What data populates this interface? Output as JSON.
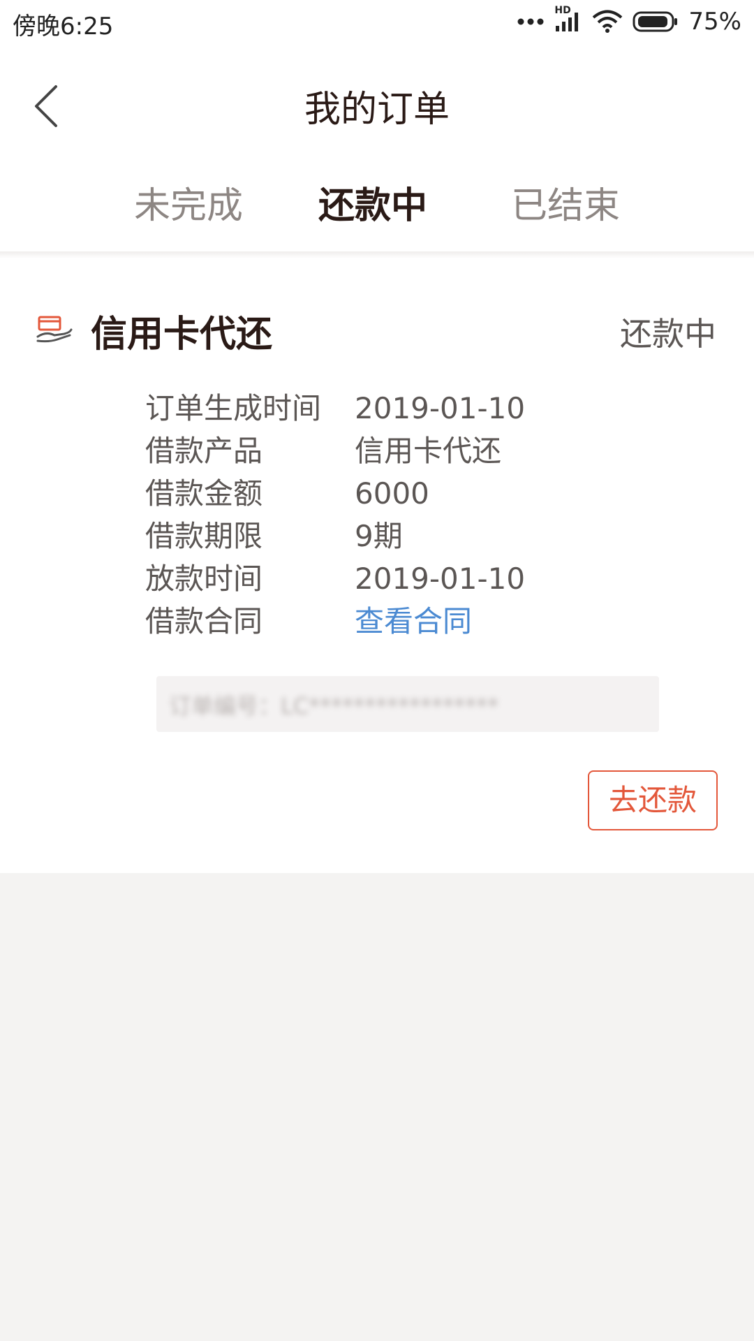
{
  "status_bar": {
    "time": "傍晚6:25",
    "battery": "75%",
    "network_badge": "HD",
    "icons": [
      "more-dots-icon",
      "signal-icon",
      "wifi-icon",
      "battery-icon"
    ]
  },
  "header": {
    "title": "我的订单",
    "back_icon": "chevron-left-icon"
  },
  "tabs": [
    {
      "label": "未完成",
      "active": false
    },
    {
      "label": "还款中",
      "active": true
    },
    {
      "label": "已结束",
      "active": false
    }
  ],
  "order": {
    "icon": "hand-card-icon",
    "title": "信用卡代还",
    "status": "还款中",
    "fields": [
      {
        "label": "订单生成时间",
        "value": "2019-01-10"
      },
      {
        "label": "借款产品",
        "value": "信用卡代还"
      },
      {
        "label": "借款金额",
        "value": "6000"
      },
      {
        "label": "借款期限",
        "value": "9期"
      },
      {
        "label": "放款时间",
        "value": "2019-01-10"
      },
      {
        "label": "借款合同",
        "value": "查看合同"
      }
    ],
    "order_number": "订单编号：LC*****************",
    "repay_button": "去还款"
  },
  "colors": {
    "accent": "#e3573a",
    "link": "#4b8ad2",
    "page_bg": "#f4f3f2"
  }
}
